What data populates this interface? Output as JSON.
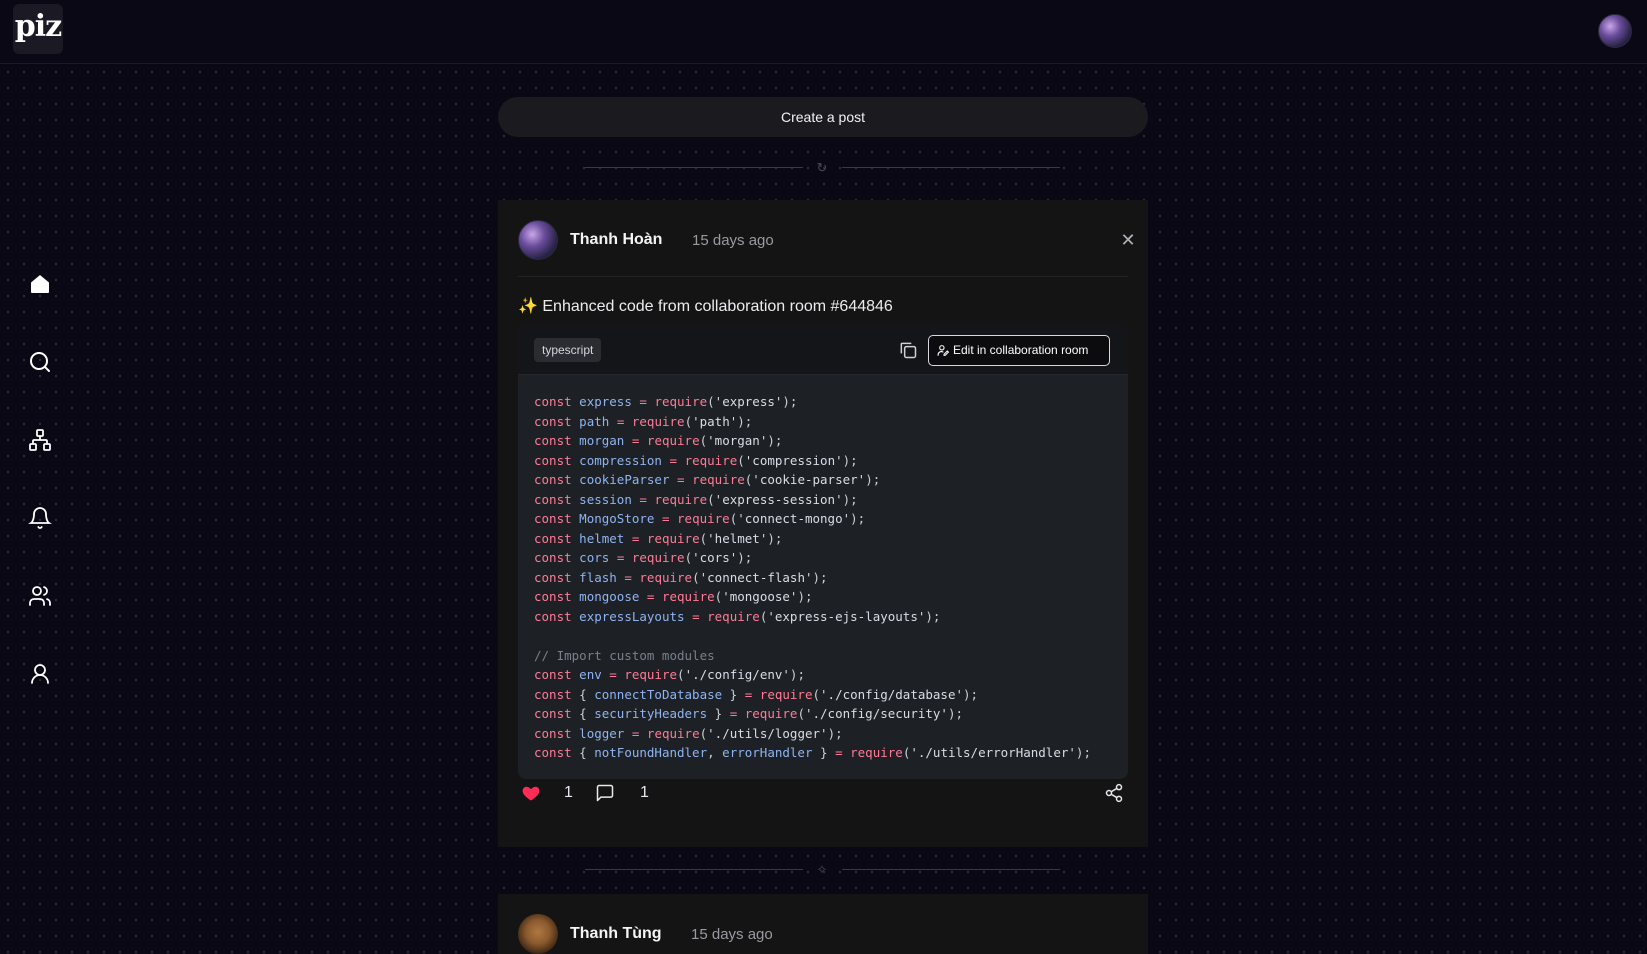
{
  "app": {
    "logo_text": "piz"
  },
  "sidebar": {
    "items": [
      {
        "name": "home",
        "icon": "home-icon"
      },
      {
        "name": "search",
        "icon": "search-icon"
      },
      {
        "name": "network",
        "icon": "network-icon"
      },
      {
        "name": "notifications",
        "icon": "bell-icon"
      },
      {
        "name": "people",
        "icon": "users-icon"
      },
      {
        "name": "profile",
        "icon": "user-icon"
      }
    ]
  },
  "create_post": {
    "label": "Create a post"
  },
  "posts": [
    {
      "author": "Thanh Hoàn",
      "time": "15 days ago",
      "title": "✨ Enhanced code from collaboration room #644846",
      "code": {
        "language": "typescript",
        "edit_label": "Edit in collaboration room",
        "lines": [
          "const express = require('express');",
          "const path = require('path');",
          "const morgan = require('morgan');",
          "const compression = require('compression');",
          "const cookieParser = require('cookie-parser');",
          "const session = require('express-session');",
          "const MongoStore = require('connect-mongo');",
          "const helmet = require('helmet');",
          "const cors = require('cors');",
          "const flash = require('connect-flash');",
          "const mongoose = require('mongoose');",
          "const expressLayouts = require('express-ejs-layouts');",
          "",
          "// Import custom modules",
          "const env = require('./config/env');",
          "const { connectToDatabase } = require('./config/database');",
          "const { securityHeaders } = require('./config/security');",
          "const logger = require('./utils/logger');",
          "const { notFoundHandler, errorHandler } = require('./utils/errorHandler');"
        ]
      },
      "likes": "1",
      "comments": "1"
    },
    {
      "author": "Thanh Tùng",
      "time": "15 days ago"
    }
  ],
  "colors": {
    "accent_heart": "#ff2d55",
    "keyword": "#ff7b96",
    "identifier": "#8fb4f0"
  }
}
